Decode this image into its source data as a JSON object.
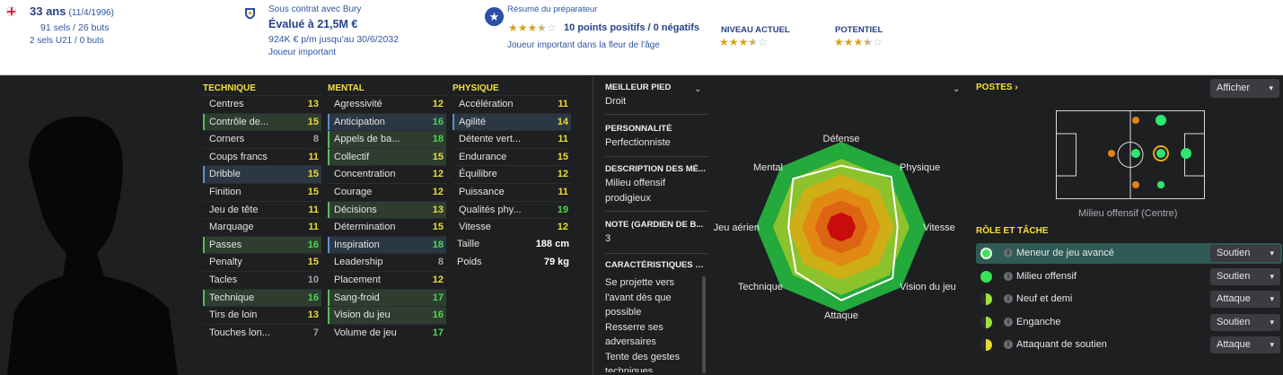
{
  "header": {
    "age": "33 ans",
    "dob": "(11/4/1996)",
    "caps": "91 sels / 26 buts",
    "u21": "2 sels U21 / 0 buts",
    "contract": "Sous contrat avec Bury",
    "value": "Évalué à 21,5M €",
    "wage": "924K € p/m jusqu'au 30/6/2032",
    "status": "Joueur important",
    "coach_title": "Résumé du préparateur",
    "coach_points": "10 points positifs / 0 négatifs",
    "coach_note": "Joueur important dans la fleur de l'âge",
    "current_label": "NIVEAU ACTUEL",
    "potential_label": "POTENTIEL",
    "coach_stars": 3.5,
    "current_stars": 3.5,
    "potential_stars": 3.5
  },
  "technique": {
    "title": "TECHNIQUE",
    "rows": [
      {
        "label": "Centres",
        "value": "13",
        "color": "yellow",
        "hl": ""
      },
      {
        "label": "Contrôle de...",
        "value": "15",
        "color": "yellow",
        "hl": "green"
      },
      {
        "label": "Corners",
        "value": "8",
        "color": "grey",
        "hl": ""
      },
      {
        "label": "Coups francs",
        "value": "11",
        "color": "yellow",
        "hl": ""
      },
      {
        "label": "Dribble",
        "value": "15",
        "color": "yellow",
        "hl": "blue"
      },
      {
        "label": "Finition",
        "value": "15",
        "color": "yellow",
        "hl": ""
      },
      {
        "label": "Jeu de tête",
        "value": "11",
        "color": "yellow",
        "hl": ""
      },
      {
        "label": "Marquage",
        "value": "11",
        "color": "yellow",
        "hl": ""
      },
      {
        "label": "Passes",
        "value": "16",
        "color": "green",
        "hl": "green"
      },
      {
        "label": "Penalty",
        "value": "15",
        "color": "yellow",
        "hl": ""
      },
      {
        "label": "Tacles",
        "value": "10",
        "color": "grey",
        "hl": ""
      },
      {
        "label": "Technique",
        "value": "16",
        "color": "green",
        "hl": "green"
      },
      {
        "label": "Tirs de loin",
        "value": "13",
        "color": "yellow",
        "hl": ""
      },
      {
        "label": "Touches lon...",
        "value": "7",
        "color": "grey",
        "hl": ""
      }
    ]
  },
  "mental": {
    "title": "MENTAL",
    "rows": [
      {
        "label": "Agressivité",
        "value": "12",
        "color": "yellow",
        "hl": ""
      },
      {
        "label": "Anticipation",
        "value": "16",
        "color": "green",
        "hl": "blue"
      },
      {
        "label": "Appels de ba...",
        "value": "18",
        "color": "green",
        "hl": "green"
      },
      {
        "label": "Collectif",
        "value": "15",
        "color": "yellow",
        "hl": "green"
      },
      {
        "label": "Concentration",
        "value": "12",
        "color": "yellow",
        "hl": ""
      },
      {
        "label": "Courage",
        "value": "12",
        "color": "yellow",
        "hl": ""
      },
      {
        "label": "Décisions",
        "value": "13",
        "color": "yellow",
        "hl": "green"
      },
      {
        "label": "Détermination",
        "value": "15",
        "color": "yellow",
        "hl": ""
      },
      {
        "label": "Inspiration",
        "value": "18",
        "color": "green",
        "hl": "blue"
      },
      {
        "label": "Leadership",
        "value": "8",
        "color": "grey",
        "hl": ""
      },
      {
        "label": "Placement",
        "value": "12",
        "color": "yellow",
        "hl": ""
      },
      {
        "label": "Sang-froid",
        "value": "17",
        "color": "green",
        "hl": "green"
      },
      {
        "label": "Vision du jeu",
        "value": "16",
        "color": "green",
        "hl": "green"
      },
      {
        "label": "Volume de jeu",
        "value": "17",
        "color": "green",
        "hl": ""
      }
    ]
  },
  "physique": {
    "title": "PHYSIQUE",
    "rows": [
      {
        "label": "Accélération",
        "value": "11",
        "color": "yellow",
        "hl": ""
      },
      {
        "label": "Agilité",
        "value": "14",
        "color": "yellow",
        "hl": "blue"
      },
      {
        "label": "Détente vert...",
        "value": "11",
        "color": "yellow",
        "hl": ""
      },
      {
        "label": "Endurance",
        "value": "15",
        "color": "yellow",
        "hl": ""
      },
      {
        "label": "Équilibre",
        "value": "12",
        "color": "yellow",
        "hl": ""
      },
      {
        "label": "Puissance",
        "value": "11",
        "color": "yellow",
        "hl": ""
      },
      {
        "label": "Qualités phy...",
        "value": "19",
        "color": "green",
        "hl": ""
      },
      {
        "label": "Vitesse",
        "value": "12",
        "color": "yellow",
        "hl": ""
      }
    ],
    "height_label": "Taille",
    "height_value": "188 cm",
    "weight_label": "Poids",
    "weight_value": "79 kg"
  },
  "info": {
    "foot_label": "MEILLEUR PIED",
    "foot_value": "Droit",
    "personality_label": "PERSONNALITÉ",
    "personality_value": "Perfectionniste",
    "media_label": "DESCRIPTION DES MÉ...",
    "media_value_1": "Milieu offensif",
    "media_value_2": "prodigieux",
    "gk_label": "NOTE (GARDIEN DE B...",
    "gk_value": "3",
    "traits_label": "CARACTÉRISTIQUES J...",
    "traits": [
      "Se projette vers",
      "l'avant dès que",
      "possible",
      "Resserre ses",
      "adversaires",
      "Tente des gestes",
      "techniques"
    ]
  },
  "radar": {
    "labels": [
      "Défense",
      "Physique",
      "Vitesse",
      "Vision du jeu",
      "Attaque",
      "Technique",
      "Jeu aérien",
      "Mental"
    ],
    "values": [
      0.72,
      0.83,
      0.66,
      0.85,
      0.86,
      0.75,
      0.62,
      0.8
    ],
    "colors": [
      "#23a93c",
      "#8cc22c",
      "#cfae16",
      "#e28914",
      "#dc6412",
      "#c80c0c"
    ]
  },
  "positions": {
    "title": "POSTES",
    "show_label": "Afficher",
    "caption": "Milieu offensif (Centre)"
  },
  "roles": {
    "title": "RÔLE ET TÂCHE",
    "items": [
      {
        "name": "Meneur de jeu avancé",
        "duty": "Soutien",
        "selected": true
      },
      {
        "name": "Milieu offensif",
        "duty": "Soutien",
        "selected": false
      },
      {
        "name": "Neuf et demi",
        "duty": "Attaque",
        "selected": false
      },
      {
        "name": "Enganche",
        "duty": "Soutien",
        "selected": false
      },
      {
        "name": "Attaquant de soutien",
        "duty": "Attaque",
        "selected": false
      }
    ]
  }
}
